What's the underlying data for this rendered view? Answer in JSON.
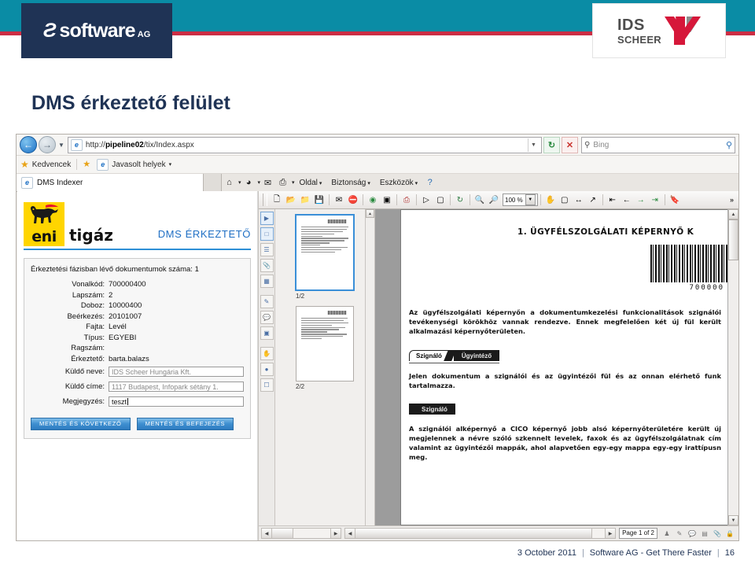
{
  "slide": {
    "title": "DMS érkeztető felület",
    "brand_left": {
      "mark": "Ƨ",
      "word": "software",
      "suffix": "AG"
    },
    "brand_right": {
      "line1": "IDS",
      "line2": "SCHEER"
    },
    "footer": {
      "date": "3 October 2011",
      "company": "Software AG - Get There Faster",
      "page": "16",
      "sep": "|"
    },
    "colors": {
      "teal": "#0a8ca5",
      "red": "#cc2e44",
      "navy": "#1f3355",
      "ids_red": "#d6173a"
    }
  },
  "browser": {
    "back_icon": "←",
    "forward_icon": "→",
    "history_caret": "▼",
    "url_prefix": "http://",
    "url_bold": "pipeline02",
    "url_suffix": "/tix/Index.aspx",
    "url_full": "http://pipeline02/tix/Index.aspx",
    "url_caret": "▼",
    "refresh_icon": "↻",
    "stop_icon": "✕",
    "search_placeholder": "Bing",
    "search_icon": "⚲",
    "search_go_icon": "⚲",
    "favorites_label": "Kedvencek",
    "star_icon": "★",
    "suggested_sites": "Javasolt helyek",
    "suggested_caret": "▾",
    "tab_title": "DMS Indexer",
    "ie_glyph": "e",
    "commands": [
      {
        "label": "Oldal",
        "caret": "▾"
      },
      {
        "label": "Biztonság",
        "caret": "▾"
      },
      {
        "label": "Eszközök",
        "caret": "▾"
      }
    ],
    "command_icons": [
      "home-icon",
      "feeds-icon",
      "mail-icon",
      "print-icon"
    ],
    "help_icon": "?"
  },
  "app": {
    "logo": {
      "eni": "eni",
      "tigaz": "tigáz"
    },
    "header_label": "DMS ÉRKEZTETŐ",
    "count_line": "Érkeztetési fázisban lévő dokumentumok száma: 1",
    "fields": [
      {
        "label": "Vonalkód:",
        "value": "700000400"
      },
      {
        "label": "Lapszám:",
        "value": "2"
      },
      {
        "label": "Doboz:",
        "value": "10000400"
      },
      {
        "label": "Beérkezés:",
        "value": "20101007"
      },
      {
        "label": "Fajta:",
        "value": "Levél"
      },
      {
        "label": "Típus:",
        "value": "EGYEBI"
      },
      {
        "label": "Ragszám:",
        "value": ""
      },
      {
        "label": "Érkeztető:",
        "value": "barta.balazs"
      }
    ],
    "inputs": [
      {
        "label": "Küldő neve:",
        "value": "IDS Scheer Hungária Kft.",
        "typed": false
      },
      {
        "label": "Küldő címe:",
        "value": "1117 Budapest, Infopark sétány 1.",
        "typed": false
      },
      {
        "label": "Megjegyzés:",
        "value": "teszt",
        "typed": true
      }
    ],
    "buttons": [
      {
        "label": "MENTÉS ÉS KÖVETKEZŐ"
      },
      {
        "label": "MENTÉS ÉS BEFEJEZÉS"
      }
    ]
  },
  "viewer": {
    "zoom_level": "100 %",
    "zoom_caret": "▼",
    "overflow_icon": "»",
    "toolbar_icons": [
      "new-icon",
      "open-icon",
      "open-web-icon",
      "save-icon",
      "email-icon",
      "stop-icon",
      "search-icon",
      "find-icon",
      "print-icon",
      "select-icon",
      "snapshot-icon",
      "rotate-icon",
      "zoom-in-icon",
      "zoom-out-icon"
    ],
    "toolbar_icons_right": [
      "hand-icon",
      "fit-page-icon",
      "fit-width-icon",
      "export-icon",
      "first-page-icon",
      "prev-page-icon",
      "next-page-icon",
      "last-page-icon",
      "bookmark-icon"
    ],
    "strip_icons": [
      "bookmarks-icon",
      "pages-icon",
      "layers-icon",
      "attachments-icon",
      "thumbnails-icon",
      "signature-icon",
      "comment-icon",
      "stamp-icon"
    ],
    "thumbnails": [
      {
        "label": "1/2",
        "selected": true
      },
      {
        "label": "2/2",
        "selected": false
      }
    ],
    "document": {
      "heading": "1.  ÜGYFÉLSZOLGÁLATI KÉPERNYŐ K",
      "barcode_number": "700000",
      "paragraph1": "Az ügyfélszolgálati képernyőn a dokumentumkezelési funkcionalitások szignálói tevékenységi körökhöz vannak rendezve. Ennek megfelelően két új fül került alkalmazási képernyőterületen.",
      "tab_active": "Szignáló",
      "tab_inactive": "Ügyintéző",
      "paragraph2": "Jelen dokumentum a szignálói és az ügyintézői fül és az onnan elérhető funk tartalmazza.",
      "tab_second": "Szignáló",
      "paragraph3": "A szignálói alképernyő a CICO képernyő jobb alsó képernyőterületére került új megjelennek a névre szóló szkennelt levelek, faxok és az ügyfélszolgálatnak cím valamint az ügyintézői mappák, ahol alapvetően egy-egy mappa egy-egy irattípusn meg."
    },
    "status": {
      "page_indicator": "Page 1 of 2",
      "icons": [
        "person-icon",
        "signature-icon",
        "comment-icon",
        "layers-icon",
        "attach-icon",
        "lock-icon"
      ]
    }
  }
}
